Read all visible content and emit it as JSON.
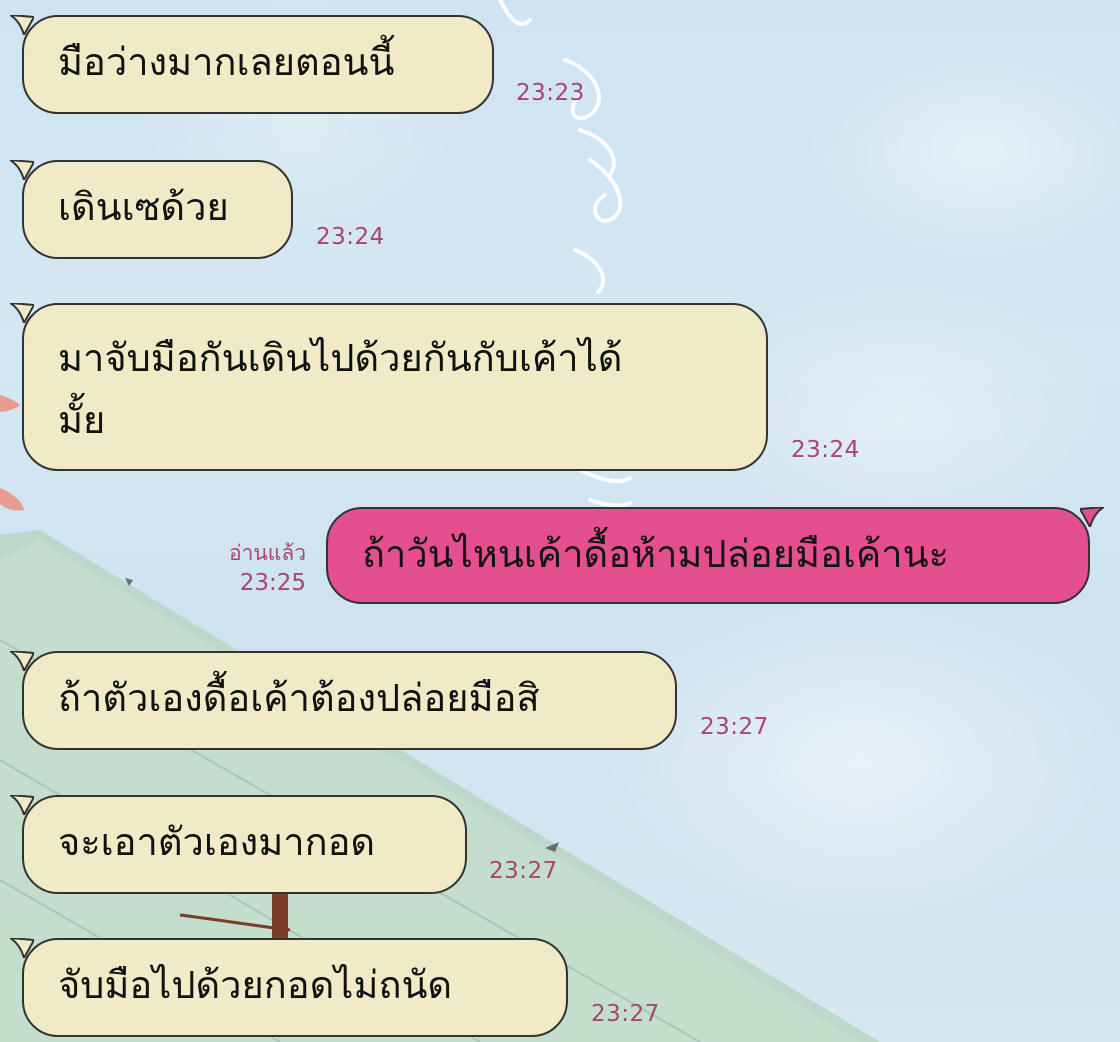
{
  "messages": [
    {
      "side": "in",
      "text": "มือว่างมากเลยตอนนี้",
      "time": "23:23"
    },
    {
      "side": "in",
      "text": "เดินเซด้วย",
      "time": "23:24"
    },
    {
      "side": "in",
      "text": "มาจับมือกันเดินไปด้วยกันกับเค้าได้มั้ย",
      "line1": "มาจับมือกันเดินไปด้วยกันกับเค้าได้",
      "line2": "มั้ย",
      "time": "23:24"
    },
    {
      "side": "out",
      "text": "ถ้าวันไหนเค้าดื้อห้ามปล่อยมือเค้านะ",
      "time": "23:25",
      "status": "อ่านแล้ว"
    },
    {
      "side": "in",
      "text": "ถ้าตัวเองดื้อเค้าต้องปล่อยมือสิ",
      "time": "23:27"
    },
    {
      "side": "in",
      "text": "จะเอาตัวเองมากอด",
      "time": "23:27"
    },
    {
      "side": "in",
      "text": "จับมือไปด้วยกอดไม่ถนัด",
      "time": "23:27"
    }
  ],
  "colors": {
    "incoming_bubble": "#f0ebc6",
    "outgoing_bubble": "#e4508f",
    "timestamp": "#a8466f",
    "bubble_border": "#333333"
  }
}
